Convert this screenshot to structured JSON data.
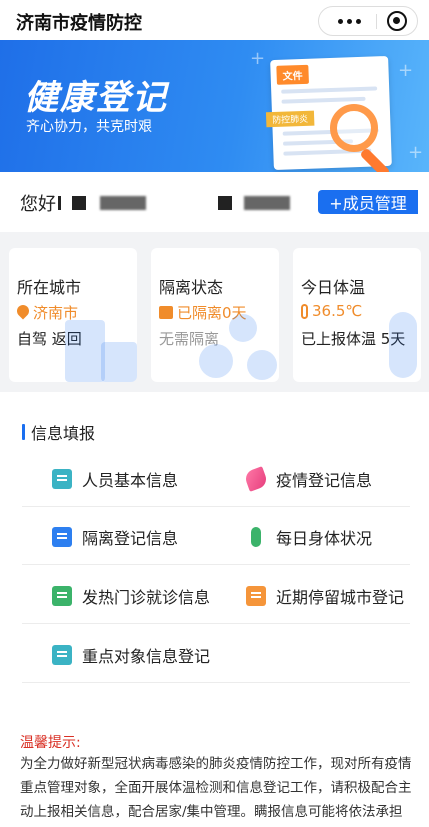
{
  "topbar": {
    "title": "济南市疫情防控"
  },
  "banner": {
    "title": "健康登记",
    "subtitle": "齐心协力，共克时艰",
    "doc_tag": "文件",
    "doc_tag2": "防控肺炎"
  },
  "greeting": {
    "hello": "您好",
    "member_button": "+成员管理"
  },
  "cards": [
    {
      "title": "所在城市",
      "value": "济南市",
      "sub": "自驾 返回"
    },
    {
      "title": "隔离状态",
      "value": "已隔离0天",
      "sub": "无需隔离"
    },
    {
      "title": "今日体温",
      "value": "36.5℃",
      "sub": "已上报体温 5天"
    }
  ],
  "info": {
    "section_title": "信息填报",
    "items": [
      {
        "label": "人员基本信息",
        "icon": "id-card-icon"
      },
      {
        "label": "疫情登记信息",
        "icon": "leaf-icon"
      },
      {
        "label": "隔离登记信息",
        "icon": "edit-form-icon"
      },
      {
        "label": "每日身体状况",
        "icon": "thermometer-icon"
      },
      {
        "label": "发热门诊就诊信息",
        "icon": "hospital-icon"
      },
      {
        "label": "近期停留城市登记",
        "icon": "building-icon"
      },
      {
        "label": "重点对象信息登记",
        "icon": "people-icon"
      }
    ]
  },
  "notice": {
    "title": "温馨提示:",
    "body": "为全力做好新型冠状病毒感染的肺炎疫情防控工作，现对所有疫情重点管理对象，全面开展体温检测和信息登记工作，请积极配合主动上报相关信息，配合居家/集中管理。瞒报信息可能将依法承担相关法"
  },
  "colors": {
    "accent": "#1a6ff0",
    "warning": "#f08c2b",
    "notice_red": "#d93025"
  }
}
